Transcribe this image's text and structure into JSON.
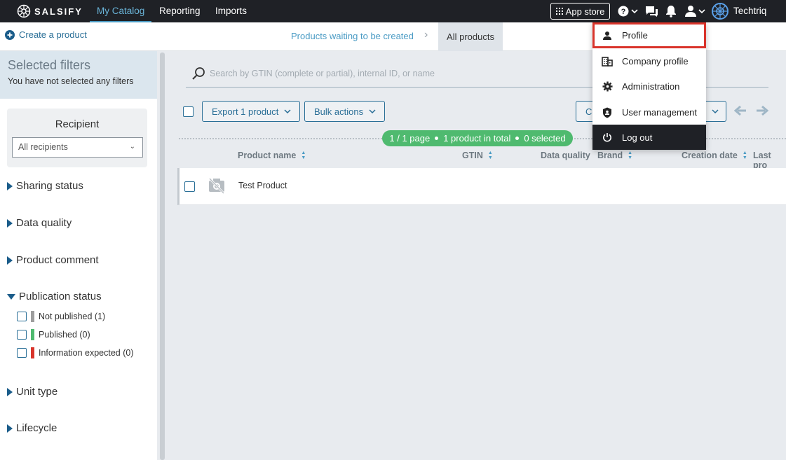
{
  "topbar": {
    "logo_text": "SALSIFY",
    "nav": [
      "My Catalog",
      "Reporting",
      "Imports"
    ],
    "app_store_label": "App store",
    "org_name": "Techtriq"
  },
  "subbar": {
    "create_label": "Create a product",
    "breadcrumb_waiting": "Products waiting to be created",
    "breadcrumb_all": "All products"
  },
  "sidebar": {
    "selected_filters_title": "Selected filters",
    "selected_filters_sub": "You have not selected any filters",
    "recipient_title": "Recipient",
    "recipient_value": "All recipients",
    "sections": {
      "sharing_status": "Sharing status",
      "data_quality": "Data quality",
      "product_comment": "Product comment",
      "publication_status": "Publication status",
      "unit_type": "Unit type",
      "lifecycle": "Lifecycle"
    },
    "publication_options": [
      {
        "label": "Not published (1)",
        "color": "#9e9e9e"
      },
      {
        "label": "Published (0)",
        "color": "#4fba6f"
      },
      {
        "label": "Information expected (0)",
        "color": "#d9342b"
      }
    ]
  },
  "main": {
    "search_placeholder": "Search by GTIN (complete or partial), internal ID, or name",
    "export_label": "Export 1 product",
    "bulk_label": "Bulk actions",
    "partial_btn_label": "Co",
    "pager": {
      "page": "1 / 1 page",
      "total": "1 product in total",
      "selected": "0 selected"
    },
    "columns": {
      "product_name": "Product name",
      "gtin": "GTIN",
      "data_quality": "Data quality",
      "brand": "Brand",
      "creation_date": "Creation date",
      "last": "Last pro"
    },
    "rows": [
      {
        "name": "Test Product"
      }
    ]
  },
  "menu": {
    "items": [
      "Profile",
      "Company profile",
      "Administration",
      "User management",
      "Log out"
    ]
  }
}
